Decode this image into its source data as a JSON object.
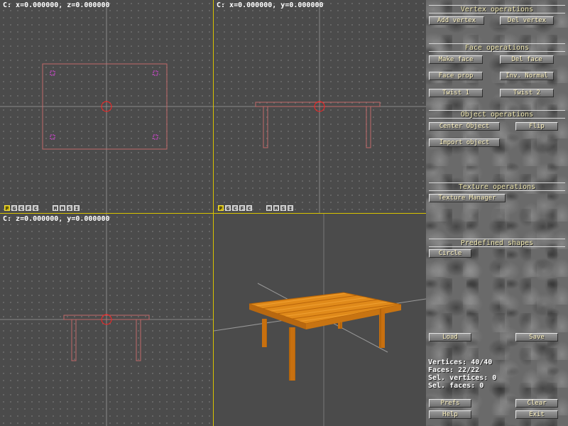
{
  "viewports": {
    "top": {
      "coords": "C: x=0.000000, z=0.000000"
    },
    "front": {
      "coords": "C: x=0.000000, y=0.000000"
    },
    "side": {
      "coords": "C: z=0.000000, y=0.000000"
    },
    "buttons": [
      "P",
      "G",
      "C",
      "F",
      "C",
      "M",
      "M",
      "S",
      "I"
    ]
  },
  "panel": {
    "vertex": {
      "title": "Vertex operations",
      "add": "Add vertex",
      "del": "Del vertex"
    },
    "face": {
      "title": "Face operations",
      "make": "Make face",
      "del": "Del face",
      "prop": "Face prop",
      "inv": "Inv. Normal",
      "twist1": "Twist 1",
      "twist2": "Twist 2"
    },
    "object": {
      "title": "Object operations",
      "center": "Center Object",
      "flip": "Flip",
      "import": "Import object"
    },
    "texture": {
      "title": "Texture operations",
      "manager": "Texture Manager"
    },
    "shapes": {
      "title": "Predefined shapes",
      "circle": "Circle"
    },
    "load": "Load",
    "save": "Save",
    "stats": {
      "vertices": "Vertices: 40/40",
      "faces": "Faces: 22/22",
      "sel_vertices": "Sel. vertices: 0",
      "sel_faces": "Sel. faces: 0"
    },
    "prefs": "Prefs",
    "clear": "Clear",
    "help": "Help",
    "exit": "Exit"
  },
  "colors": {
    "grid_axis": "#8a8a8a",
    "cursor": "#ff2020",
    "vertex_marker": "#e040e0",
    "object_edges": "#e06060",
    "viewport_divider": "#d9c400",
    "table_wood": "#e08a1a"
  }
}
